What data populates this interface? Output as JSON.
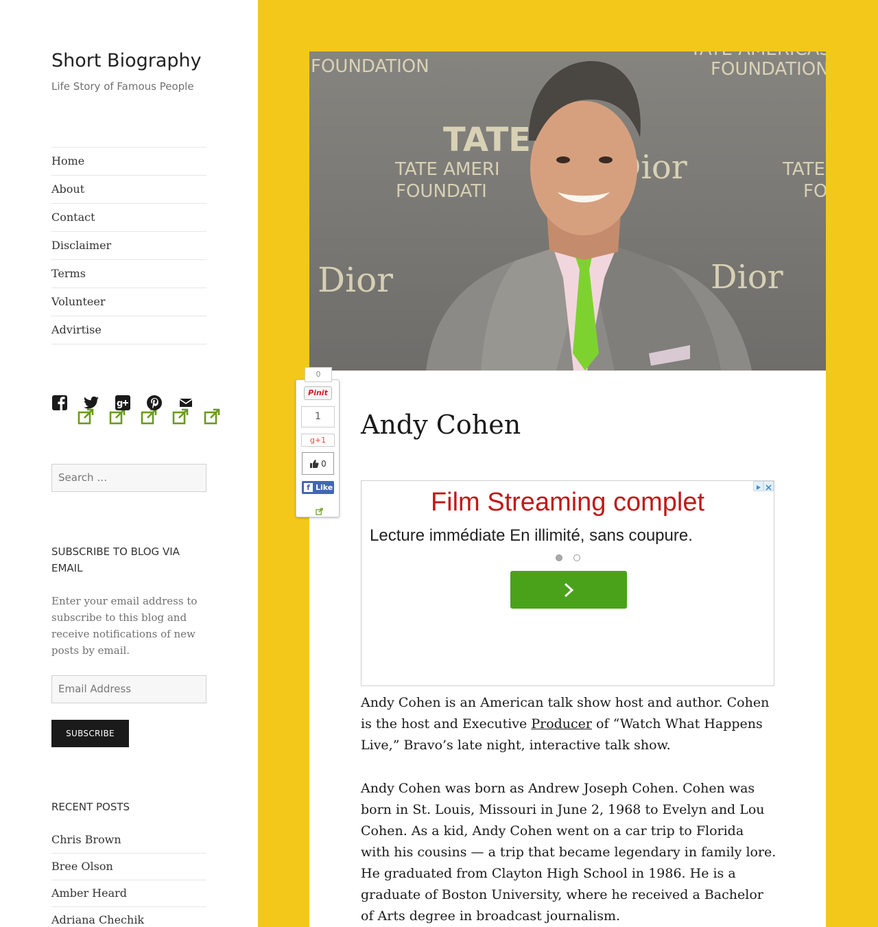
{
  "site": {
    "title": "Short Biography",
    "description": "Life Story of Famous People"
  },
  "nav": {
    "items": [
      {
        "label": "Home"
      },
      {
        "label": "About"
      },
      {
        "label": "Contact"
      },
      {
        "label": "Disclaimer"
      },
      {
        "label": "Terms"
      },
      {
        "label": "Volunteer"
      },
      {
        "label": "Advirtise"
      }
    ]
  },
  "social": {
    "icons": [
      "facebook-icon",
      "twitter-icon",
      "google-plus-icon",
      "pinterest-icon",
      "email-icon"
    ]
  },
  "search": {
    "placeholder": "Search …"
  },
  "subscribe": {
    "title": "SUBSCRIBE TO BLOG VIA EMAIL",
    "text": "Enter your email address to subscribe to this blog and receive notifications of new posts by email.",
    "email_placeholder": "Email Address",
    "button": "SUBSCRIBE"
  },
  "recent": {
    "title": "RECENT POSTS",
    "items": [
      {
        "label": "Chris Brown"
      },
      {
        "label": "Bree Olson"
      },
      {
        "label": "Amber Heard"
      },
      {
        "label": "Adriana Chechik"
      }
    ]
  },
  "article": {
    "title": "Andy Cohen",
    "para1_pre": "Andy Cohen is an American talk show host and author. Cohen is the host and Executive ",
    "para1_link": "Producer",
    "para1_post": " of “Watch What Happens Live,” Bravo’s late night, interactive talk show.",
    "para2": "Andy Cohen was born as Andrew Joseph Cohen. Cohen was born in St. Louis, Missouri in June 2, 1968 to Evelyn and Lou Cohen. As a kid, Andy Cohen went on a car trip to Florida with his cousins — a trip that became legendary in family lore. He graduated from Clayton High School in 1986. He is a graduate of Boston University, where he received a Bachelor of Arts degree in broadcast journalism."
  },
  "hero": {
    "backdrop_texts": [
      "FOUNDATION",
      "TATE AMERICAS FOUNDATION",
      "TATE",
      "TATE AMERI",
      "FOUNDATI",
      "Dior",
      "TATE",
      "FOU",
      "Dior",
      "Dior"
    ]
  },
  "ad": {
    "headline": "Film Streaming complet",
    "subline": "Lecture immédiate En illimité, sans coupure."
  },
  "share": {
    "pin_count": "0",
    "pin_label": "Pinit",
    "gplus_count": "1",
    "gplus_label": "+1",
    "fb_count": "0",
    "fb_like": "Like"
  },
  "colors": {
    "background": "#f3c81a",
    "ad_headline": "#c11818",
    "ad_button": "#4aa21a",
    "fb_blue": "#4267b2"
  }
}
